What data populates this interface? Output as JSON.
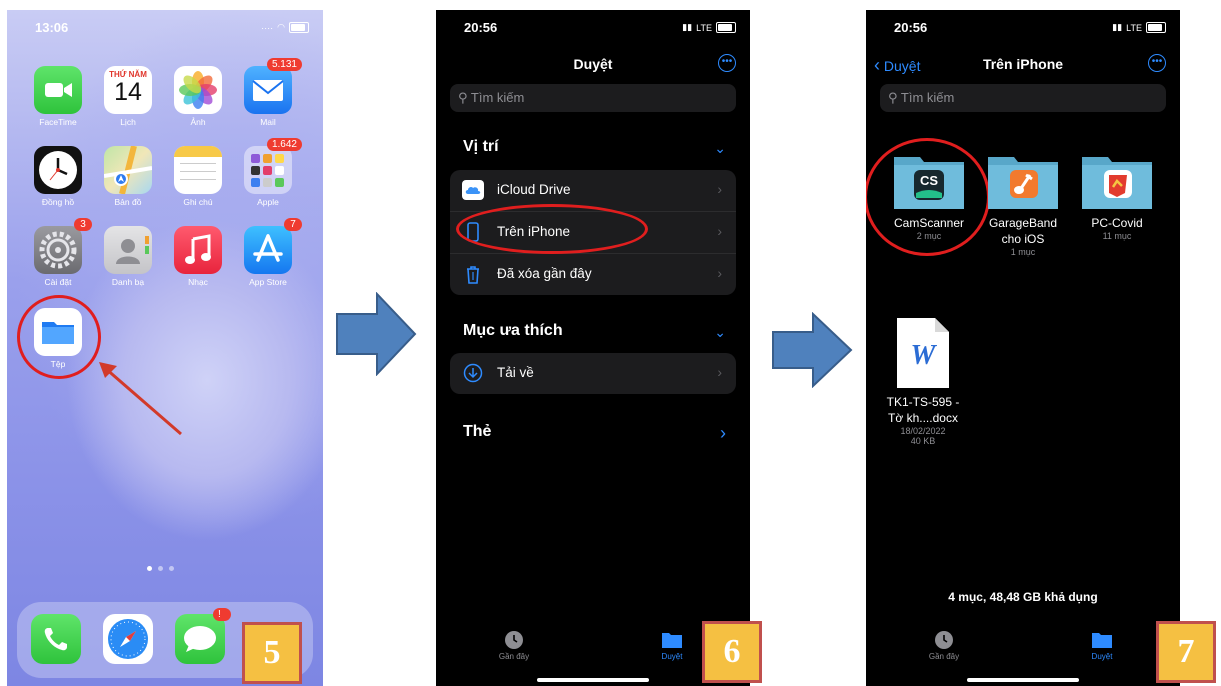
{
  "screen1": {
    "time": "13:06",
    "calendar": {
      "weekday": "THỨ NĂM",
      "day": "14"
    },
    "apps": [
      {
        "name": "facetime",
        "label": "FaceTime",
        "badge": ""
      },
      {
        "name": "calendar",
        "label": "Lịch",
        "badge": ""
      },
      {
        "name": "photos",
        "label": "Ảnh",
        "badge": ""
      },
      {
        "name": "mail",
        "label": "Mail",
        "badge": "5.131"
      },
      {
        "name": "clock",
        "label": "Đồng hồ",
        "badge": ""
      },
      {
        "name": "maps",
        "label": "Bản đồ",
        "badge": ""
      },
      {
        "name": "notes",
        "label": "Ghi chú",
        "badge": ""
      },
      {
        "name": "apple-folder",
        "label": "Apple",
        "badge": "1.642"
      },
      {
        "name": "settings",
        "label": "Cài đặt",
        "badge": "3"
      },
      {
        "name": "contacts",
        "label": "Danh bạ",
        "badge": ""
      },
      {
        "name": "music",
        "label": "Nhạc",
        "badge": ""
      },
      {
        "name": "appstore",
        "label": "App Store",
        "badge": "7"
      },
      {
        "name": "files",
        "label": "Tệp",
        "badge": ""
      }
    ],
    "dock_messages_badge": "!",
    "step": "5"
  },
  "screen2": {
    "time": "20:56",
    "carrier": "LTE",
    "title": "Duyệt",
    "search_placeholder": "Tìm kiếm",
    "section_locations": "Vị trí",
    "locations": [
      "iCloud Drive",
      "Trên iPhone",
      "Đã xóa gần đây"
    ],
    "section_favorites": "Mục ưa thích",
    "favorites": [
      "Tải về"
    ],
    "section_tags": "Thẻ",
    "tab_recents": "Gần đây",
    "tab_browse": "Duyệt",
    "step": "6"
  },
  "screen3": {
    "time": "20:56",
    "carrier": "LTE",
    "back_label": "Duyệt",
    "title": "Trên iPhone",
    "search_placeholder": "Tìm kiếm",
    "items": [
      {
        "name": "CamScanner",
        "count": "2 mục"
      },
      {
        "name": "GarageBand cho iOS",
        "count": "1 mục"
      },
      {
        "name": "PC-Covid",
        "count": "11 mục"
      }
    ],
    "camscanner_logo": "CS",
    "doc": {
      "name_line1": "TK1-TS-595 -",
      "name_line2": "Tờ kh....docx",
      "date": "18/02/2022",
      "size": "40 KB"
    },
    "storage": "4 mục, 48,48 GB khả dụng",
    "tab_recents": "Gần đây",
    "tab_browse": "Duyệt",
    "step": "7"
  },
  "colors": {
    "accent": "#2e8bff",
    "highlight": "#e01e1e",
    "step_box": "#f5c042",
    "arrow": "#4f81bd"
  }
}
